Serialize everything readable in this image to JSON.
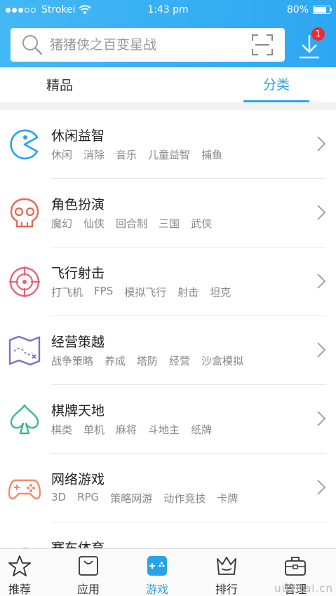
{
  "status_bar": {
    "carrier": "Strokei",
    "time": "1:43 pm",
    "battery": "80%",
    "battery_level": 0.8
  },
  "search": {
    "placeholder": "猪猪侠之百变星战"
  },
  "download": {
    "badge_count": "1"
  },
  "tabs": [
    {
      "label": "精品",
      "active": false
    },
    {
      "label": "分类",
      "active": true
    }
  ],
  "categories": [
    {
      "title": "休闲益智",
      "icon": "pacman-icon",
      "tags": [
        "休闲",
        "消除",
        "音乐",
        "儿童益智",
        "捕鱼"
      ]
    },
    {
      "title": "角色扮演",
      "icon": "skull-icon",
      "tags": [
        "魔幻",
        "仙侠",
        "回合制",
        "三国",
        "武侠"
      ]
    },
    {
      "title": "飞行射击",
      "icon": "crosshair-icon",
      "tags": [
        "打飞机",
        "FPS",
        "模拟飞行",
        "射击",
        "坦克"
      ]
    },
    {
      "title": "经营策越",
      "icon": "map-icon",
      "tags": [
        "战争策略",
        "养成",
        "塔防",
        "经营",
        "沙盒模拟"
      ]
    },
    {
      "title": "棋牌天地",
      "icon": "spade-icon",
      "tags": [
        "棋类",
        "单机",
        "麻将",
        "斗地主",
        "纸牌"
      ]
    },
    {
      "title": "网络游戏",
      "icon": "gamepad-icon",
      "tags": [
        "3D",
        "RPG",
        "策略网游",
        "动作竞技",
        "卡牌"
      ]
    },
    {
      "title": "赛车体育",
      "icon": "racing-icon",
      "tags": []
    }
  ],
  "tabbar": [
    {
      "label": "推荐",
      "icon": "star-icon",
      "active": false
    },
    {
      "label": "应用",
      "icon": "bag-icon",
      "active": false
    },
    {
      "label": "游戏",
      "icon": "game-icon",
      "active": true
    },
    {
      "label": "排行",
      "icon": "crown-icon",
      "active": false
    },
    {
      "label": "管理",
      "icon": "toolbox-icon",
      "active": false
    }
  ],
  "watermark": "uuxitai.cn",
  "colors": {
    "accent": "#29a3e6",
    "header": "#3aaef4",
    "badge": "#e92b2b"
  }
}
